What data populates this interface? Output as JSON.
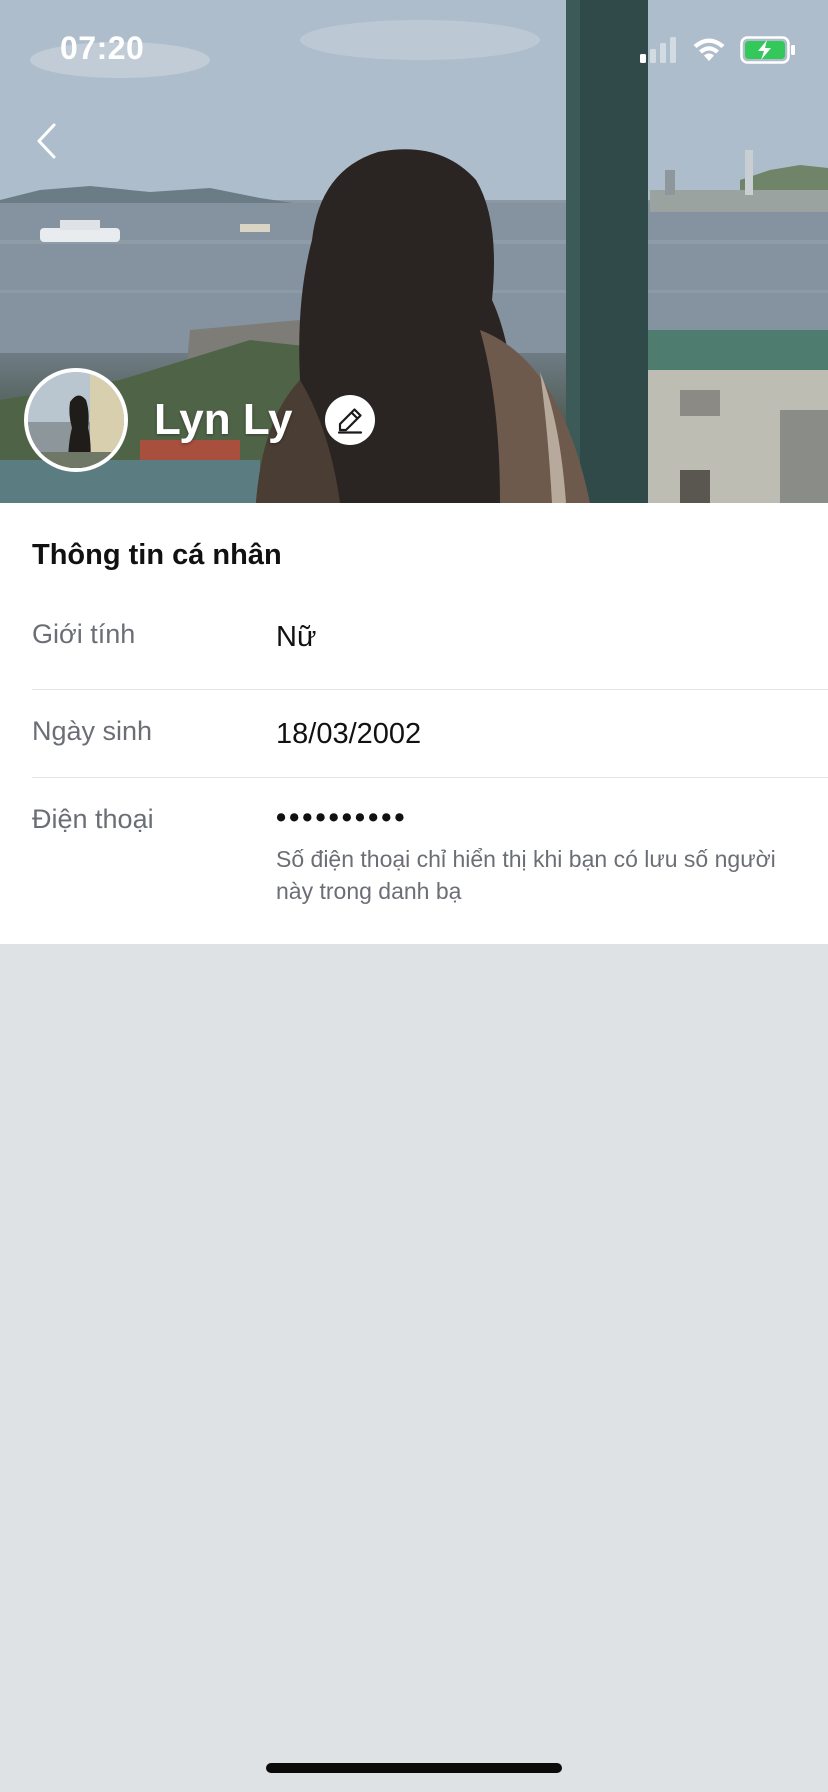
{
  "status_bar": {
    "time": "07:20",
    "signal_icon": "cellular-signal-icon",
    "wifi_icon": "wifi-icon",
    "battery_icon": "battery-charging-icon",
    "battery_color": "#34c759"
  },
  "header": {
    "back_icon": "chevron-left-icon",
    "name": "Lyn Ly",
    "edit_icon": "pencil-icon"
  },
  "personal_info": {
    "title": "Thông tin cá nhân",
    "rows": [
      {
        "label": "Giới tính",
        "value": "Nữ"
      },
      {
        "label": "Ngày sinh",
        "value": "18/03/2002"
      },
      {
        "label": "Điện thoại",
        "value": "••••••••••",
        "note": "Số điện thoại chỉ hiển thị khi bạn có lưu số người này trong danh bạ"
      }
    ]
  },
  "colors": {
    "background": "#dfe2e5",
    "card": "#ffffff",
    "label_gray": "#6b6f75"
  }
}
